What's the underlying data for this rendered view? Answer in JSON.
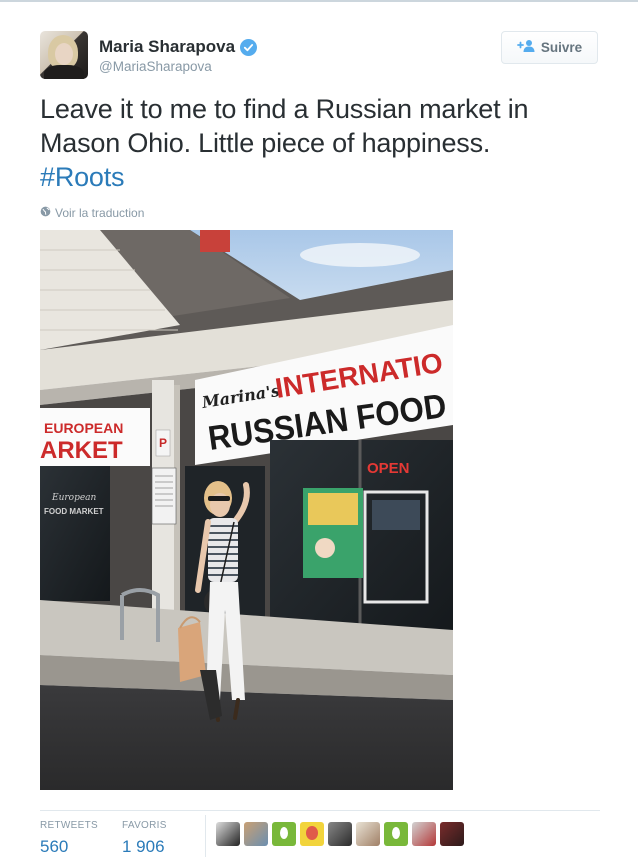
{
  "tweet": {
    "user": {
      "name": "Maria Sharapova",
      "handle": "@MariaSharapova",
      "verified": true
    },
    "follow_button": {
      "label": "Suivre",
      "icon": "add-user-icon"
    },
    "text_lines": [
      "Leave it to me to find a Russian market in",
      "Mason Ohio. Little piece of happiness."
    ],
    "hashtag": "#Roots",
    "translate_link": "Voir la traduction",
    "photo": {
      "signs": {
        "left_line1": "EUROPEAN",
        "left_line2": "ARKET",
        "main_script": "Marina's",
        "main_line1": "INTERNATIO",
        "main_line2": "RUSSIAN FOOD",
        "open_sign": "OPEN",
        "window_text": "European",
        "window_text2": "FOOD MARKET",
        "parking": "P"
      }
    },
    "stats": [
      {
        "label": "RETWEETS",
        "value": "560"
      },
      {
        "label": "FAVORIS",
        "value": "1 906"
      }
    ],
    "favoriters_count": 9
  },
  "colors": {
    "link": "#2b7bb9",
    "muted": "#8899a6",
    "verified": "#55acee",
    "text": "#292f33",
    "sign_red": "#cc2a2a"
  }
}
